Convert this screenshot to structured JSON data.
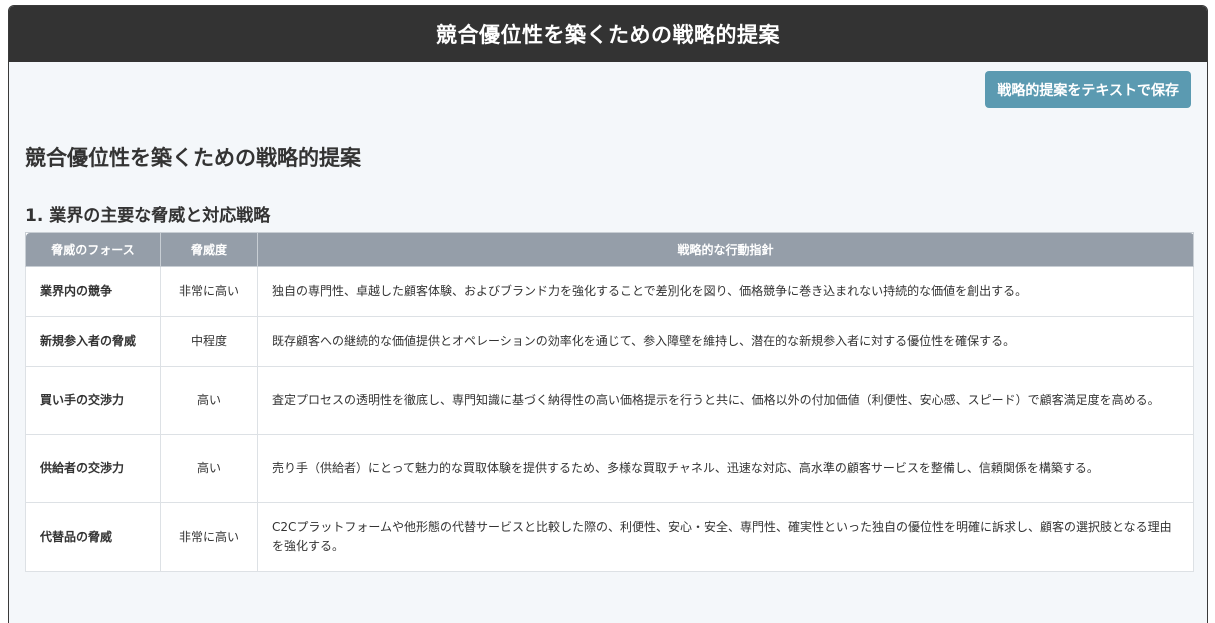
{
  "window": {
    "title": "競合優位性を築くための戦略的提案"
  },
  "toolbar": {
    "save_label": "戦略的提案をテキストで保存"
  },
  "document": {
    "title": "競合優位性を築くための戦略的提案",
    "section_title": "1. 業界の主要な脅威と対応戦略"
  },
  "table": {
    "headers": [
      "脅威のフォース",
      "脅威度",
      "戦略的な行動指針"
    ],
    "rows": [
      {
        "force": "業界内の競争",
        "level": "非常に高い",
        "strategy": "独自の専門性、卓越した顧客体験、およびブランド力を強化することで差別化を図り、価格競争に巻き込まれない持続的な価値を創出する。"
      },
      {
        "force": "新規参入者の脅威",
        "level": "中程度",
        "strategy": "既存顧客への継続的な価値提供とオペレーションの効率化を通じて、参入障壁を維持し、潜在的な新規参入者に対する優位性を確保する。"
      },
      {
        "force": "買い手の交渉力",
        "level": "高い",
        "strategy": "査定プロセスの透明性を徹底し、専門知識に基づく納得性の高い価格提示を行うと共に、価格以外の付加価値（利便性、安心感、スピード）で顧客満足度を高める。"
      },
      {
        "force": "供給者の交渉力",
        "level": "高い",
        "strategy": "売り手（供給者）にとって魅力的な買取体験を提供するため、多様な買取チャネル、迅速な対応、高水準の顧客サービスを整備し、信頼関係を構築する。"
      },
      {
        "force": "代替品の脅威",
        "level": "非常に高い",
        "strategy": "C2Cプラットフォームや他形態の代替サービスと比較した際の、利便性、安心・安全、専門性、確実性といった独自の優位性を明確に訴求し、顧客の選択肢となる理由を強化する。"
      }
    ]
  }
}
